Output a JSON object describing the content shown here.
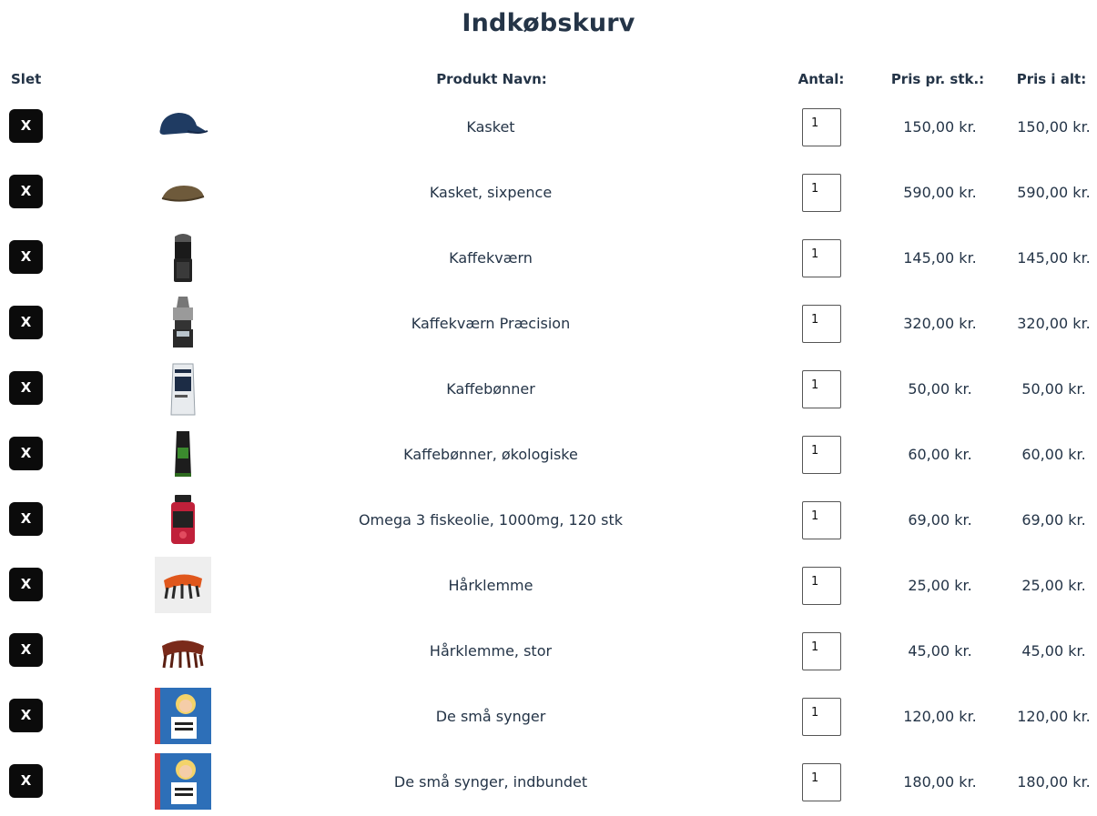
{
  "page": {
    "title": "Indkøbskurv"
  },
  "table": {
    "headers": {
      "delete": "Slet",
      "name": "Produkt Navn:",
      "quantity": "Antal:",
      "unit_price": "Pris pr. stk.:",
      "total": "Pris i alt:"
    },
    "delete_label": "X",
    "rows": [
      {
        "name": "Kasket",
        "quantity": "1",
        "unit_price": "150,00 kr.",
        "total": "150,00 kr.",
        "icon": "cap-blue-icon"
      },
      {
        "name": "Kasket, sixpence",
        "quantity": "1",
        "unit_price": "590,00 kr.",
        "total": "590,00 kr.",
        "icon": "cap-sixpence-icon"
      },
      {
        "name": "Kaffekværn",
        "quantity": "1",
        "unit_price": "145,00 kr.",
        "total": "145,00 kr.",
        "icon": "coffee-grinder-icon"
      },
      {
        "name": "Kaffekværn Præcision",
        "quantity": "1",
        "unit_price": "320,00 kr.",
        "total": "320,00 kr.",
        "icon": "coffee-grinder-precision-icon"
      },
      {
        "name": "Kaffebønner",
        "quantity": "1",
        "unit_price": "50,00 kr.",
        "total": "50,00 kr.",
        "icon": "coffee-bag-white-icon"
      },
      {
        "name": "Kaffebønner, økologiske",
        "quantity": "1",
        "unit_price": "60,00 kr.",
        "total": "60,00 kr.",
        "icon": "coffee-bag-green-icon"
      },
      {
        "name": "Omega 3 fiskeolie, 1000mg, 120 stk",
        "quantity": "1",
        "unit_price": "69,00 kr.",
        "total": "69,00 kr.",
        "icon": "supplement-jar-icon"
      },
      {
        "name": "Hårklemme",
        "quantity": "1",
        "unit_price": "25,00 kr.",
        "total": "25,00 kr.",
        "icon": "hair-clip-orange-icon"
      },
      {
        "name": "Hårklemme, stor",
        "quantity": "1",
        "unit_price": "45,00 kr.",
        "total": "45,00 kr.",
        "icon": "hair-clip-brown-icon"
      },
      {
        "name": "De små synger",
        "quantity": "1",
        "unit_price": "120,00 kr.",
        "total": "120,00 kr.",
        "icon": "book-cover-icon"
      },
      {
        "name": "De små synger, indbundet",
        "quantity": "1",
        "unit_price": "180,00 kr.",
        "total": "180,00 kr.",
        "icon": "book-cover-hardback-icon"
      }
    ]
  }
}
